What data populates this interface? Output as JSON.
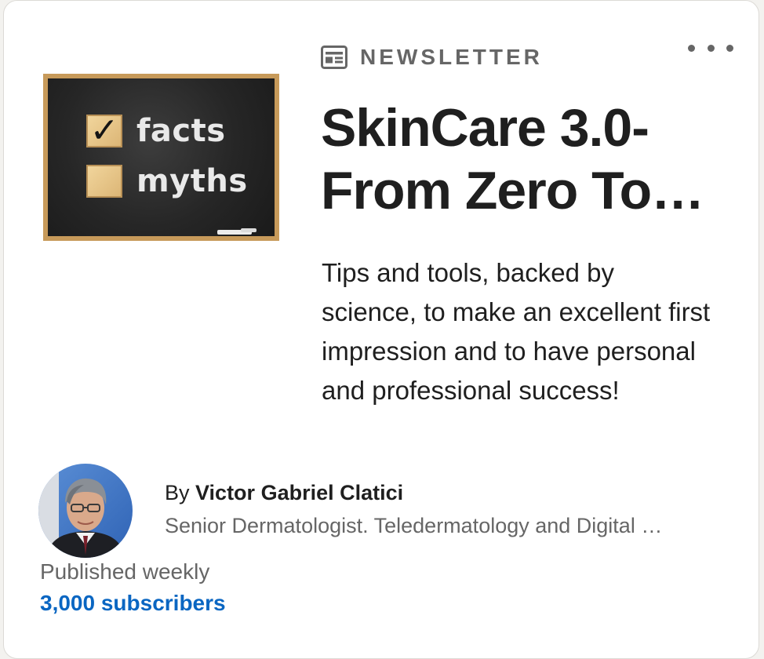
{
  "newsletter": {
    "kicker_label": "NEWSLETTER",
    "kicker_icon": "newsletter-icon",
    "title": "SkinCare 3.0- From Zero To…",
    "description": "Tips and tools, backed by science, to make an excellent first impression and to have personal and professional success!",
    "cover": {
      "checked_box": "✓",
      "row1_word": "facts",
      "row2_word": "myths"
    },
    "more_icon": "more-options-icon"
  },
  "author": {
    "by_prefix": "By",
    "name": "Victor Gabriel Clatici",
    "headline": "Senior Dermatologist. Teledermatology and Digital …"
  },
  "meta": {
    "frequency": "Published weekly",
    "subscribers": "3,000 subscribers"
  },
  "colors": {
    "accent_link": "#0a66c2",
    "text_primary": "#1f1f1f",
    "text_secondary": "#666666",
    "card_background": "#ffffff"
  }
}
